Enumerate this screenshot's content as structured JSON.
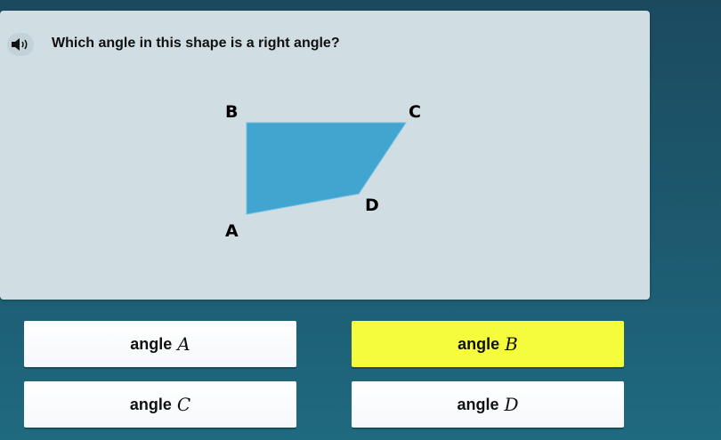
{
  "question": {
    "text": "Which angle in this shape is a right angle?",
    "speaker_icon": "speaker-icon"
  },
  "shape": {
    "fill_color": "#41a5cf",
    "vertices": [
      {
        "label": "A"
      },
      {
        "label": "B"
      },
      {
        "label": "C"
      },
      {
        "label": "D"
      }
    ]
  },
  "answers": [
    {
      "prefix": "angle",
      "variable": "A",
      "selected": false
    },
    {
      "prefix": "angle",
      "variable": "B",
      "selected": true
    },
    {
      "prefix": "angle",
      "variable": "C",
      "selected": false
    },
    {
      "prefix": "angle",
      "variable": "D",
      "selected": false
    }
  ],
  "colors": {
    "selected_answer": "#f5fc3c",
    "card_background": "#d0dde2"
  }
}
